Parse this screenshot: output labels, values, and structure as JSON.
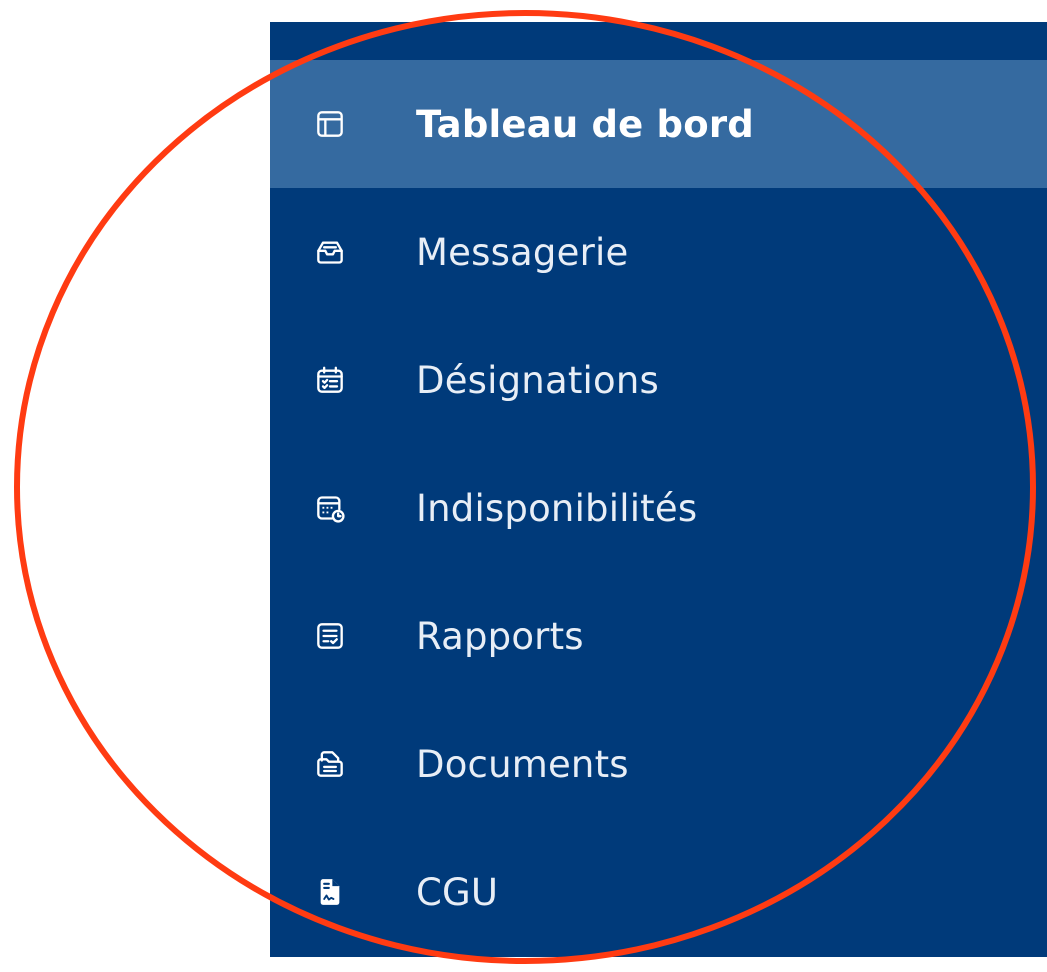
{
  "sidebar": {
    "background": "#003a7a",
    "active_background": "#356aa0",
    "items": [
      {
        "label": "Tableau de bord",
        "icon": "layout-icon",
        "active": true
      },
      {
        "label": "Messagerie",
        "icon": "inbox-icon",
        "active": false
      },
      {
        "label": "Désignations",
        "icon": "calendar-check-icon",
        "active": false
      },
      {
        "label": "Indisponibilités",
        "icon": "calendar-clock-icon",
        "active": false
      },
      {
        "label": "Rapports",
        "icon": "report-check-icon",
        "active": false
      },
      {
        "label": "Documents",
        "icon": "folder-document-icon",
        "active": false
      },
      {
        "label": "CGU",
        "icon": "file-signature-icon",
        "active": false
      }
    ]
  },
  "annotation": {
    "ring_color": "#ff3b12"
  }
}
